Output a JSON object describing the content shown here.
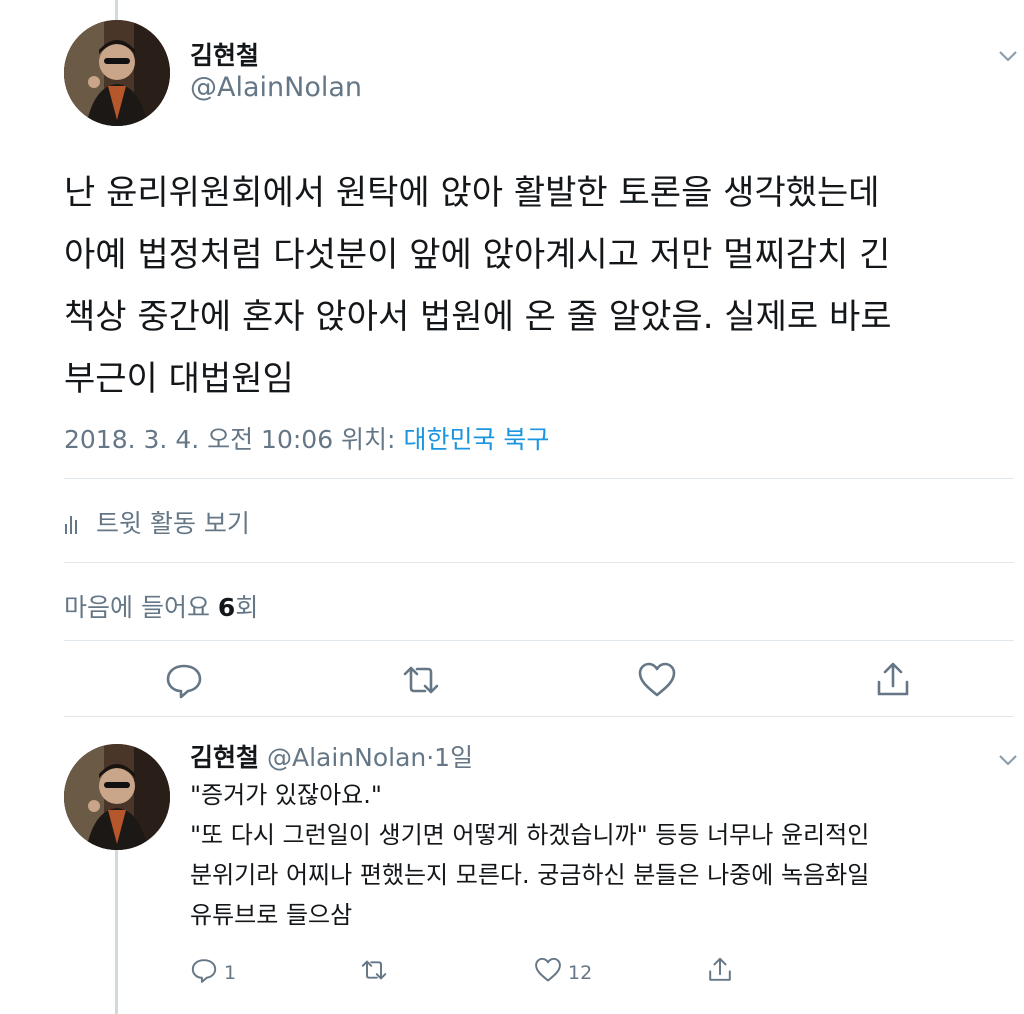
{
  "tweet": {
    "author_name": "김현철",
    "author_handle": "@AlainNolan",
    "text": "난 윤리위원회에서 원탁에 앉아 활발한 토론을 생각했는데\n아예 법정처럼 다섯분이 앞에 앉아계시고 저만 멀찌감치 긴\n책상 중간에 혼자 앉아서 법원에 온 줄 알았음. 실제로 바로\n부근이 대법원임",
    "timestamp": "2018. 3. 4. 오전 10:06 위치: ",
    "location": "대한민국 북구",
    "activity_label": "트윗 활동 보기",
    "likes_prefix": "마음에 들어요 ",
    "likes_count": "6",
    "likes_suffix": "회"
  },
  "reply": {
    "author_name": "김현철",
    "author_handle": " @AlainNolan",
    "age": "·1일",
    "text": "\"증거가 있잖아요.\"\n\"또 다시 그런일이 생기면 어떻게 하겠습니까\" 등등 너무나 윤리적인\n분위기라 어찌나 편했는지 모른다. 궁금하신 분들은 나중에 녹음화일\n유튜브로 들으삼",
    "reply_count": "1",
    "like_count": "12"
  },
  "icons": {
    "reply": "reply-icon",
    "retweet": "retweet-icon",
    "like": "heart-icon",
    "share": "share-icon",
    "activity": "bar-chart-icon",
    "menu": "chevron-down-icon"
  },
  "colors": {
    "text": "#14171a",
    "secondary": "#657786",
    "link": "#1b95e0",
    "divider": "#e1e8ed"
  }
}
